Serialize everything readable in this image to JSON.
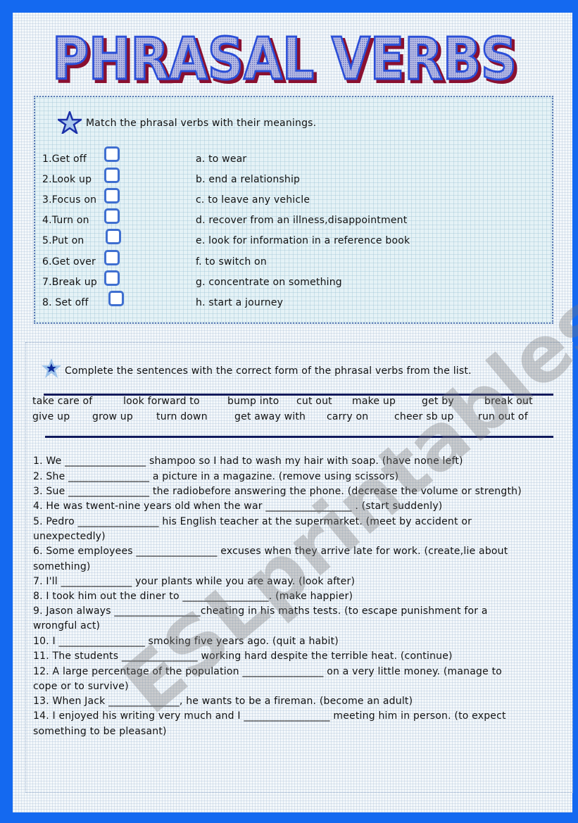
{
  "title": "PHRASAL VERBS",
  "exercise1": {
    "instruction": "Match the phrasal verbs with their meanings.",
    "verbs": [
      "1.Get off",
      "2.Look up",
      "3.Focus on",
      "4.Turn on",
      "5.Put on",
      "6.Get over",
      "7.Break up",
      "8. Set off"
    ],
    "meanings": [
      "a. to wear",
      "b. end a relationship",
      "c. to leave any vehicle",
      "d. recover from an illness,disappointment",
      "e. look for information in a reference book",
      "f. to switch on",
      "g. concentrate on something",
      "h. start a journey"
    ]
  },
  "exercise2": {
    "instruction": "Complete the sentences with the correct form of the phrasal verbs from the list.",
    "word_bank_row1": [
      "take care of",
      "look forward to",
      "bump into",
      "cut out",
      "make up",
      "get by",
      "break out"
    ],
    "word_bank_row2": [
      "give up",
      "grow up",
      "turn down",
      "get away with",
      "carry on",
      "cheer sb up",
      "run out of"
    ],
    "lines": [
      "1. We ________________ shampoo so I had to wash my hair with soap. (have none left)",
      "2. She ________________ a picture in a magazine. (remove using scissors)",
      "3. Sue ________________ the radiobefore answering the phone. (decrease the volume or strength)",
      "4. He was twent-nine years old when the war _________________ . (start suddenly)",
      "5. Pedro ________________ his English teacher at the supermarket. (meet by accident or",
      "unexpectedly)",
      "6. Some employees ________________ excuses when they arrive late for work. (create,lie about",
      "something)",
      "7. I'll ______________ your plants while you are away. (look after)",
      "8. I took him out the diner to _________________. (make happier)",
      "9. Jason always _________________cheating in his maths tests. (to escape punishment for a",
      "wrongful act)",
      "10. I _________________ smoking five years ago. (quit a habit)",
      "11. The students _______________ working hard despite the terrible heat. (continue)",
      "12. A large percentage of the population ________________ on a very little money. (manage to",
      "cope or to survive)",
      "13. When Jack ______________, he wants to be a fireman. (become an adult)",
      "14. I enjoyed his writing very much and I _________________ meeting him in person. (to expect",
      "something to be pleasant)"
    ]
  },
  "watermark": "ESLprintables.com",
  "colors": {
    "frame": "#1469f0",
    "title_fill": "#9aa3d8",
    "title_stroke": "#2b4fd8",
    "title_shadow": "#8a1030",
    "rule": "#101a5c",
    "checkbox": "#3f6fd0"
  }
}
